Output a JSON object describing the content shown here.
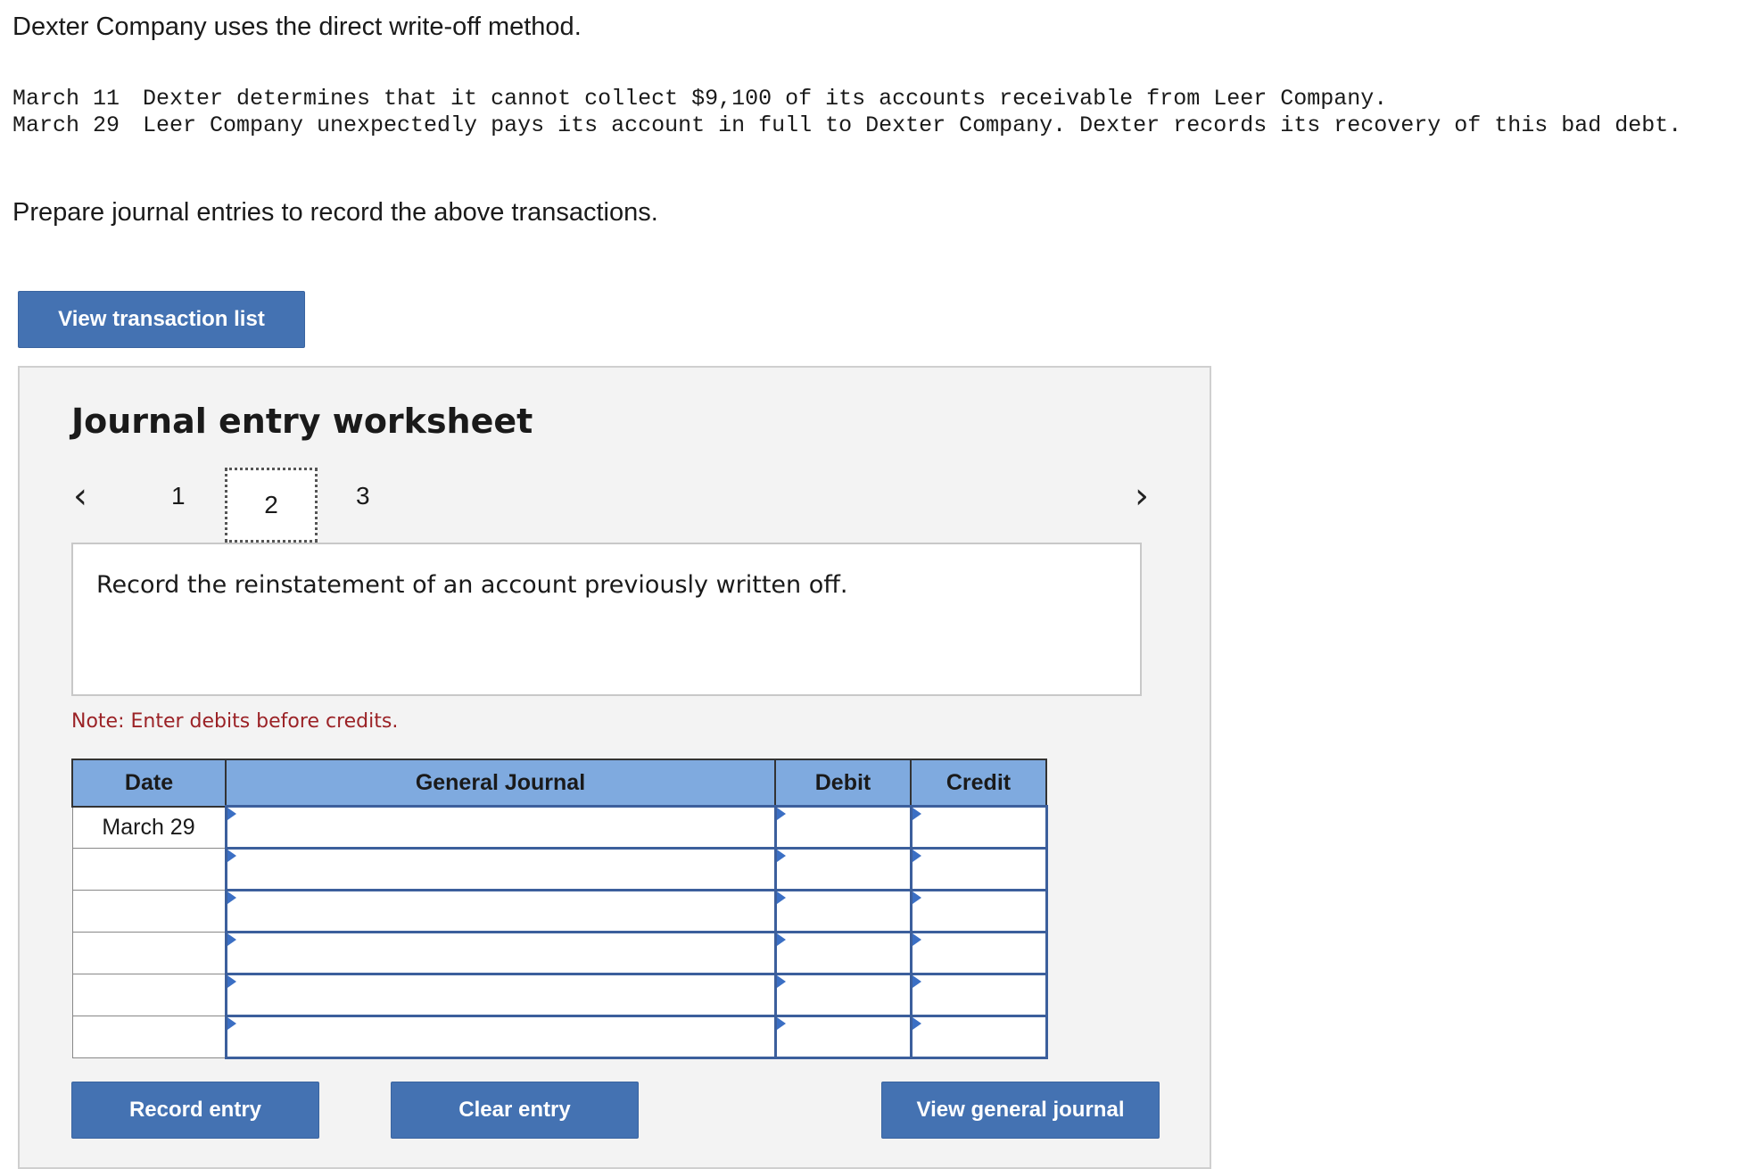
{
  "intro": "Dexter Company uses the direct write-off method.",
  "transactions": [
    {
      "date": "March 11",
      "text": "Dexter determines that it cannot collect $9,100 of its accounts receivable from Leer Company."
    },
    {
      "date": "March 29",
      "text": "Leer Company unexpectedly pays its account in full to Dexter Company. Dexter records its recovery of this bad debt."
    }
  ],
  "prompt": "Prepare journal entries to record the above transactions.",
  "view_transaction_list_label": "View transaction list",
  "worksheet": {
    "title": "Journal entry worksheet",
    "prev_icon": "chevron-left-icon",
    "next_icon": "chevron-right-icon",
    "pages": [
      "1",
      "2",
      "3"
    ],
    "active_page": "2",
    "description": "Record the reinstatement of an account previously written off.",
    "note": "Note: Enter debits before credits.",
    "columns": [
      "Date",
      "General Journal",
      "Debit",
      "Credit"
    ],
    "rows": [
      {
        "date": "March 29",
        "account": "",
        "debit": "",
        "credit": ""
      },
      {
        "date": "",
        "account": "",
        "debit": "",
        "credit": ""
      },
      {
        "date": "",
        "account": "",
        "debit": "",
        "credit": ""
      },
      {
        "date": "",
        "account": "",
        "debit": "",
        "credit": ""
      },
      {
        "date": "",
        "account": "",
        "debit": "",
        "credit": ""
      },
      {
        "date": "",
        "account": "",
        "debit": "",
        "credit": ""
      }
    ],
    "record_entry_label": "Record entry",
    "clear_entry_label": "Clear entry",
    "view_general_journal_label": "View general journal"
  }
}
